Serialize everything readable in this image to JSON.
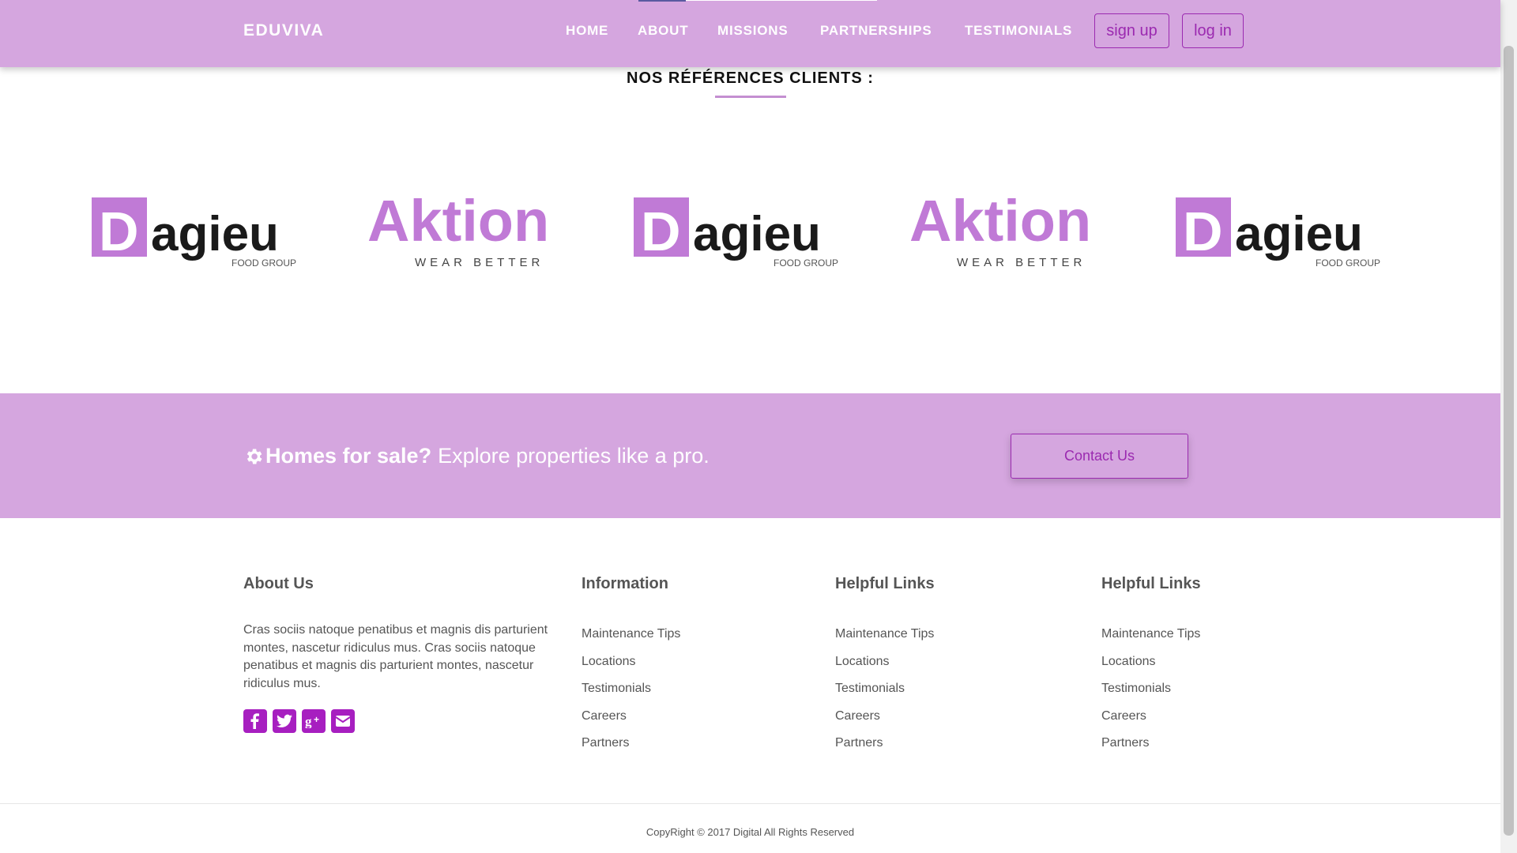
{
  "navbar": {
    "brand": "EDUVIVA",
    "items": [
      {
        "label": "HOME"
      },
      {
        "label": "ABOUT"
      },
      {
        "label": "MISSIONS"
      },
      {
        "label": "PARTNERSHIPS"
      },
      {
        "label": "TESTIMONIALS"
      }
    ],
    "signup_label": "sign up",
    "login_label": "log in"
  },
  "clients": {
    "title": "NOS RÉFÉRENCES CLIENTS :",
    "logos": [
      {
        "name": "Dagieu",
        "sub": "FOOD GROUP"
      },
      {
        "name": "Aktion",
        "sub": "WEAR BETTER"
      },
      {
        "name": "Dagieu",
        "sub": "FOOD GROUP"
      },
      {
        "name": "Aktion",
        "sub": "WEAR BETTER"
      },
      {
        "name": "Dagieu",
        "sub": "FOOD GROUP"
      }
    ]
  },
  "banner": {
    "bold_text": "Homes for sale?",
    "text": "Explore properties like a pro.",
    "button_label": "Contact Us"
  },
  "footer": {
    "about": {
      "heading": "About Us",
      "text": "Cras sociis natoque penatibus et magnis dis parturient montes, nascetur ridiculus mus. Cras sociis natoque penatibus et magnis dis parturient montes, nascetur ridiculus mus."
    },
    "social": [
      {
        "icon": "facebook-icon"
      },
      {
        "icon": "twitter-icon"
      },
      {
        "icon": "google-plus-icon"
      },
      {
        "icon": "envelope-icon"
      }
    ],
    "columns": [
      {
        "heading": "Information",
        "links": [
          "Maintenance Tips",
          "Locations",
          "Testimonials",
          "Careers",
          "Partners"
        ]
      },
      {
        "heading": "Helpful Links",
        "links": [
          "Maintenance Tips",
          "Locations",
          "Testimonials",
          "Careers",
          "Partners"
        ]
      },
      {
        "heading": "Helpful Links",
        "links": [
          "Maintenance Tips",
          "Locations",
          "Testimonials",
          "Careers",
          "Partners"
        ]
      }
    ],
    "copyright": "CopyRight © 2017 Digital All Rights Reserved"
  },
  "colors": {
    "accent": "#d5a6df",
    "button": "#9b2ab0",
    "logo_purple": "#c07ad6"
  }
}
